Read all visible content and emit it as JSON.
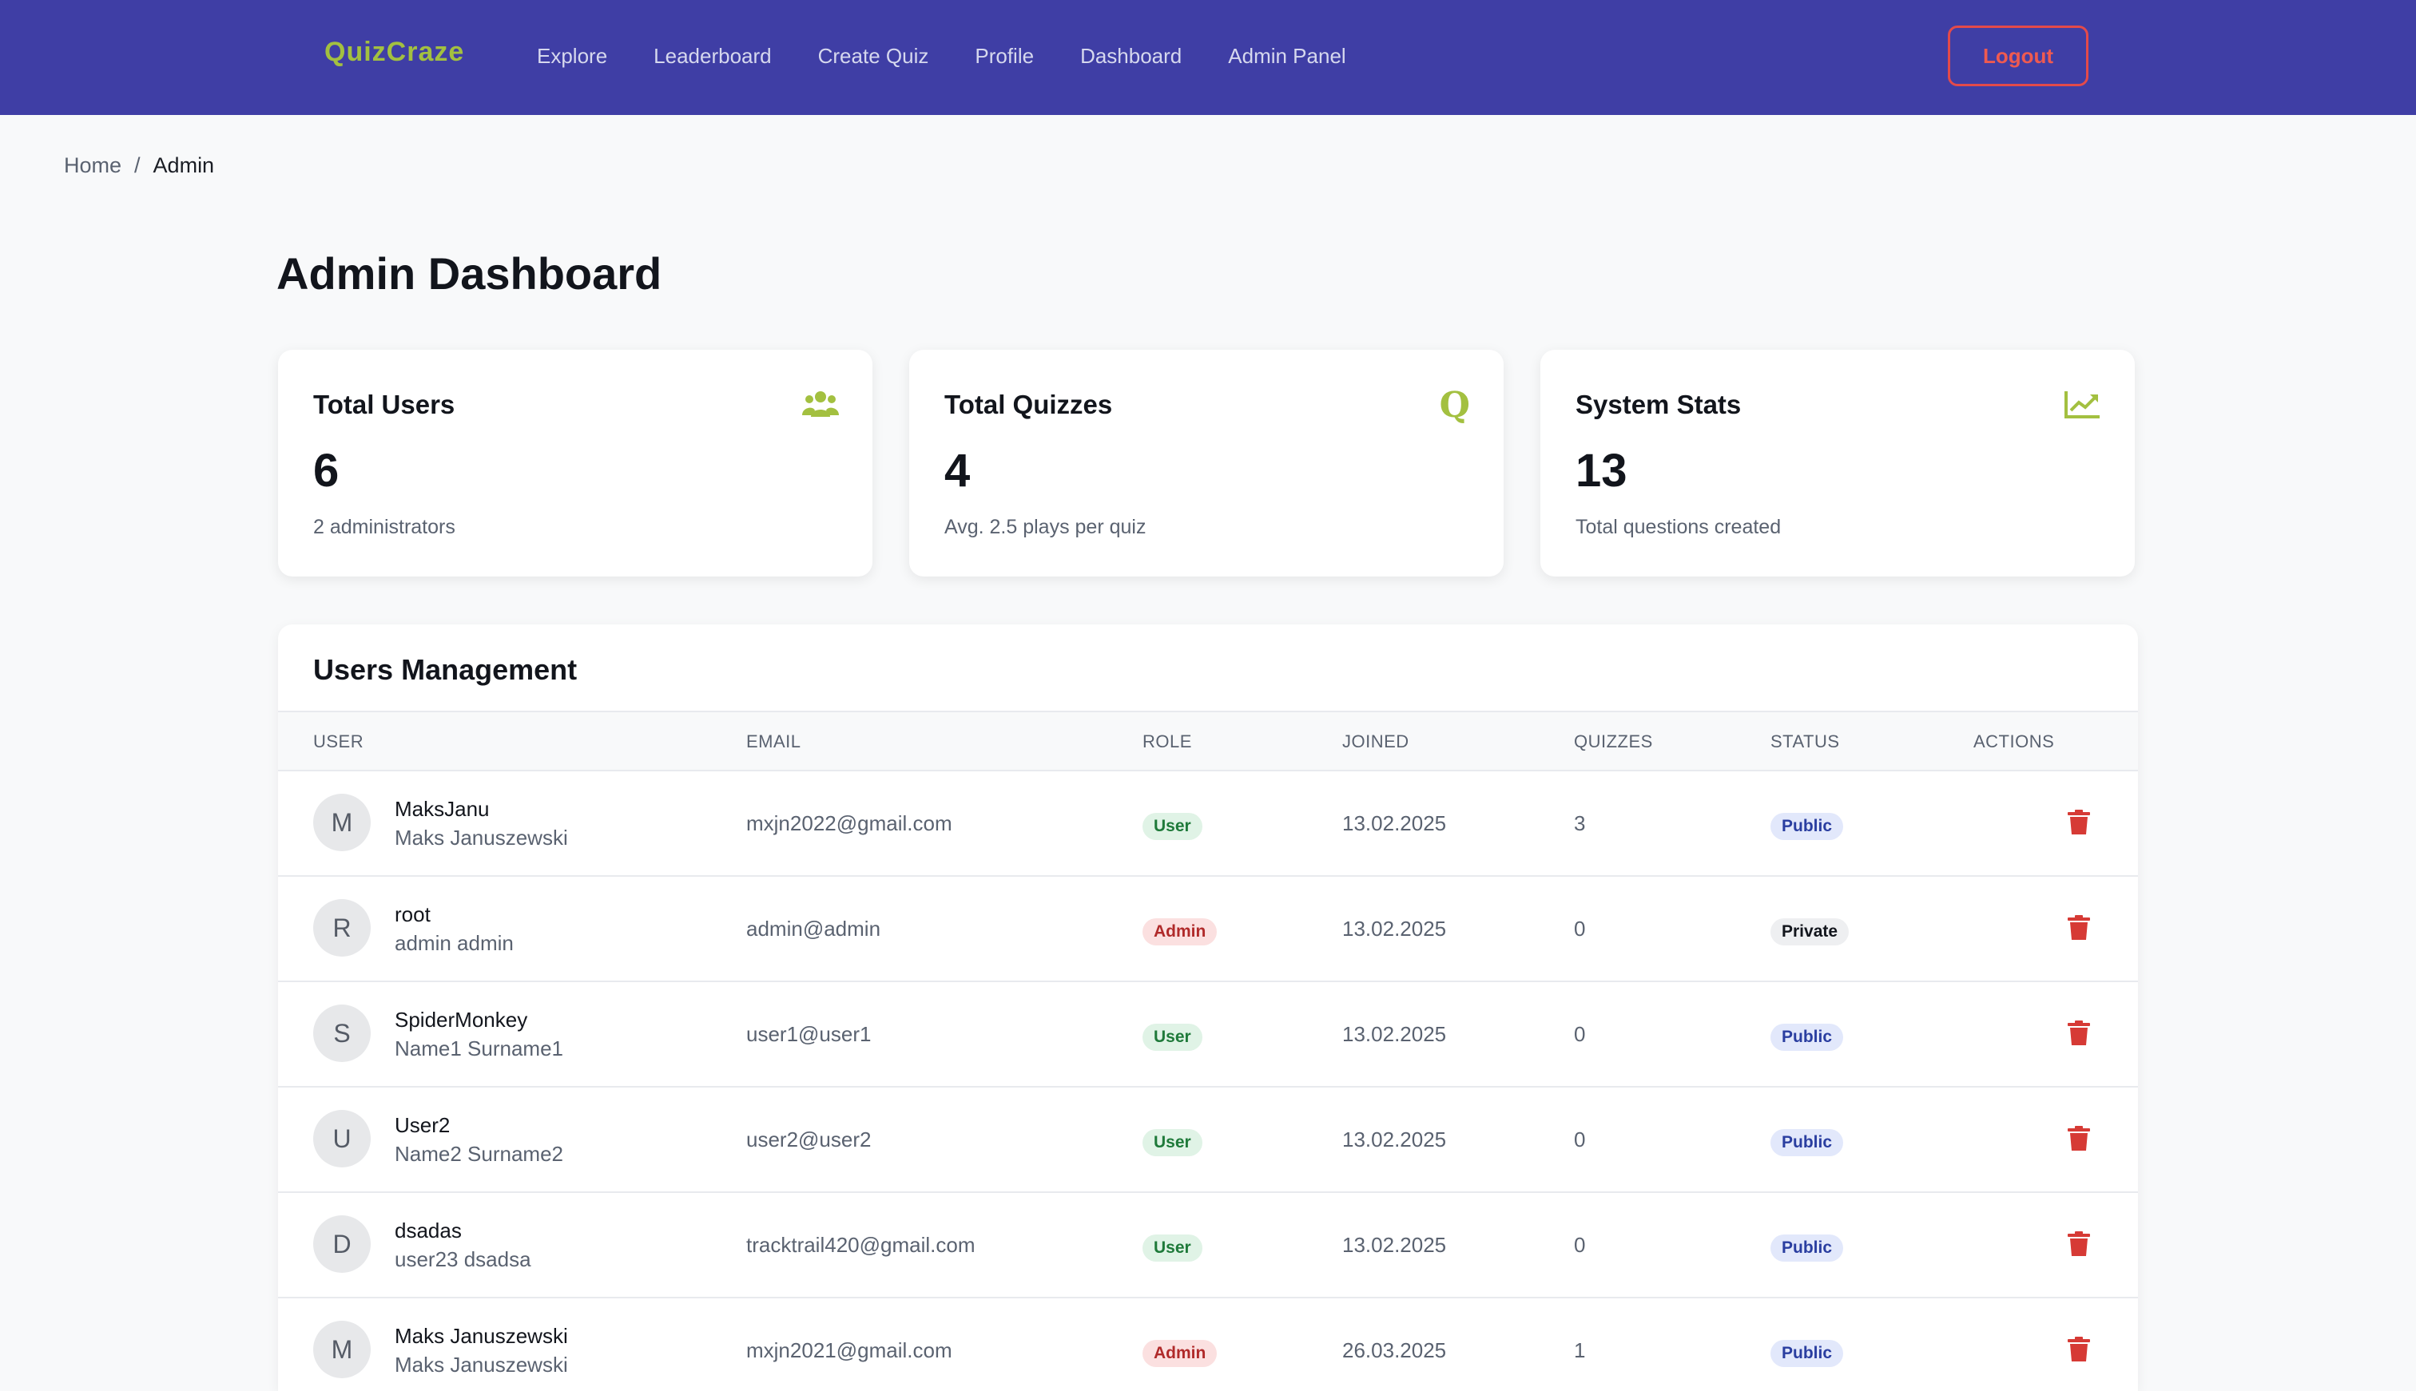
{
  "navbar": {
    "brand": "QuizCraze",
    "links": [
      "Explore",
      "Leaderboard",
      "Create Quiz",
      "Profile",
      "Dashboard",
      "Admin Panel"
    ],
    "logout_label": "Logout",
    "colors": {
      "background": "#3f3ea5",
      "brand": "#a3c040",
      "logout": "#e44a4a"
    }
  },
  "breadcrumb": {
    "home": "Home",
    "separator": "/",
    "current": "Admin"
  },
  "page_title": "Admin Dashboard",
  "stats": [
    {
      "title": "Total Users",
      "value": "6",
      "subtitle": "2 administrators",
      "icon": "users-icon"
    },
    {
      "title": "Total Quizzes",
      "value": "4",
      "subtitle": "Avg. 2.5 plays per quiz",
      "icon": "quiz-q-icon",
      "icon_glyph": "Q"
    },
    {
      "title": "System Stats",
      "value": "13",
      "subtitle": "Total questions created",
      "icon": "chart-line-icon"
    }
  ],
  "users": {
    "title": "Users Management",
    "columns": [
      "USER",
      "EMAIL",
      "ROLE",
      "JOINED",
      "QUIZZES",
      "STATUS",
      "ACTIONS"
    ],
    "rows": [
      {
        "initial": "M",
        "username": "MaksJanu",
        "full_name": "Maks Januszewski",
        "email": "mxjn2022@gmail.com",
        "role": "User",
        "joined": "13.02.2025",
        "quizzes": "3",
        "status": "Public"
      },
      {
        "initial": "R",
        "username": "root",
        "full_name": "admin admin",
        "email": "admin@admin",
        "role": "Admin",
        "joined": "13.02.2025",
        "quizzes": "0",
        "status": "Private"
      },
      {
        "initial": "S",
        "username": "SpiderMonkey",
        "full_name": "Name1 Surname1",
        "email": "user1@user1",
        "role": "User",
        "joined": "13.02.2025",
        "quizzes": "0",
        "status": "Public"
      },
      {
        "initial": "U",
        "username": "User2",
        "full_name": "Name2 Surname2",
        "email": "user2@user2",
        "role": "User",
        "joined": "13.02.2025",
        "quizzes": "0",
        "status": "Public"
      },
      {
        "initial": "D",
        "username": "dsadas",
        "full_name": "user23 dsadsa",
        "email": "tracktrail420@gmail.com",
        "role": "User",
        "joined": "13.02.2025",
        "quizzes": "0",
        "status": "Public"
      },
      {
        "initial": "M",
        "username": "Maks Januszewski",
        "full_name": "Maks Januszewski",
        "email": "mxjn2021@gmail.com",
        "role": "Admin",
        "joined": "26.03.2025",
        "quizzes": "1",
        "status": "Public"
      }
    ],
    "action_icon": "trash-icon",
    "colors": {
      "user_badge": "#1f7a3a",
      "admin_badge": "#b02a2a",
      "public_badge": "#2a3ea0",
      "delete": "#d63a35"
    }
  }
}
